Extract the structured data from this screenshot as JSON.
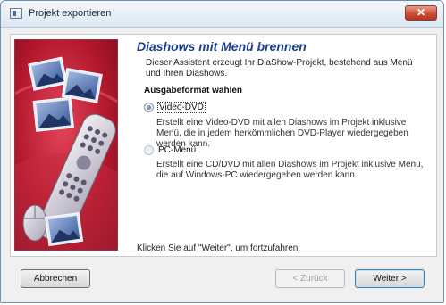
{
  "window": {
    "title": "Projekt exportieren",
    "close_label": "✕"
  },
  "page": {
    "heading": "Diashows mit Menü brennen",
    "description": "Dieser Assistent erzeugt Ihr DiaShow-Projekt, bestehend aus Menü und Ihren Diashows.",
    "section_label": "Ausgabeformat wählen",
    "options": [
      {
        "label": "Video-DVD",
        "selected": true,
        "description": "Erstellt eine Video-DVD mit allen Diashows im Projekt inklusive Menü, die in jedem herkömmlichen DVD-Player wiedergegeben werden kann."
      },
      {
        "label": "PC-Menü",
        "selected": false,
        "description": "Erstellt eine CD/DVD mit allen Diashows im Projekt inklusive Menü, die auf Windows-PC wiedergegeben werden kann."
      }
    ],
    "footer_hint": "Klicken Sie auf \"Weiter\", um fortzufahren."
  },
  "buttons": {
    "cancel": "Abbrechen",
    "back": "< Zurück",
    "next": "Weiter >"
  },
  "colors": {
    "heading": "#1b3e8c",
    "sidebar_red": "#b3172c"
  }
}
